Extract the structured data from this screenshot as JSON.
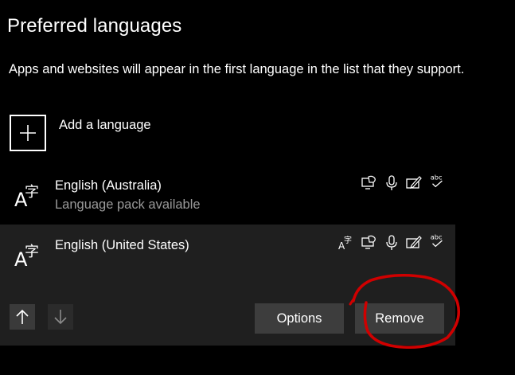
{
  "section": {
    "title": "Preferred languages",
    "description": "Apps and websites will appear in the first language in the list that they support."
  },
  "add_language": {
    "label": "Add a language",
    "icon": "plus-icon"
  },
  "languages": [
    {
      "name": "English (Australia)",
      "status": "Language pack available",
      "icon": "language-icon",
      "features": [
        "text-to-speech-icon",
        "microphone-icon",
        "handwriting-icon",
        "spelling-icon"
      ],
      "selected": false
    },
    {
      "name": "English (United States)",
      "status": "",
      "icon": "language-icon",
      "features": [
        "display-language-icon",
        "text-to-speech-icon",
        "microphone-icon",
        "handwriting-icon",
        "spelling-icon"
      ],
      "selected": true
    }
  ],
  "actions": {
    "move_up_icon": "arrow-up-icon",
    "move_down_icon": "arrow-down-icon",
    "options_label": "Options",
    "remove_label": "Remove"
  },
  "annotation": {
    "color": "#d00000"
  },
  "colors": {
    "background": "#000000",
    "selected_row": "#1f1f1f",
    "button": "#3d3d3d",
    "secondary_text": "#9a9a9a"
  }
}
